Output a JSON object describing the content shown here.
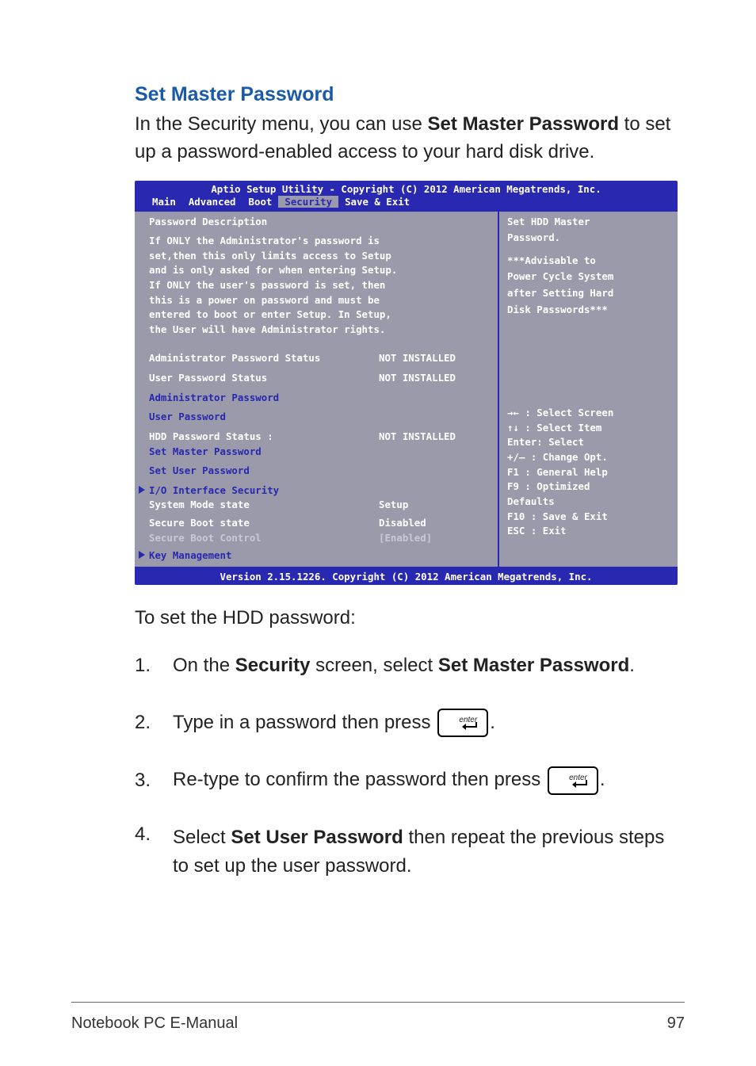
{
  "heading": "Set Master Password",
  "intro_before": "In the Security menu, you can use ",
  "intro_bold": "Set Master Password",
  "intro_after": " to set up a password-enabled access to your hard disk drive.",
  "bios": {
    "title": "Aptio Setup Utility - Copyright (C) 2012 American Megatrends, Inc.",
    "tabs": [
      "Main",
      "Advanced",
      "Boot",
      "Security",
      "Save & Exit"
    ],
    "active_tab_index": 3,
    "left": {
      "section_title": "Password Description",
      "desc_lines": [
        "If ONLY the Administrator's password is",
        "set,then this only limits access to Setup",
        "and is only asked for when entering Setup.",
        "If ONLY the user's password is set, then",
        "this is a power on password and must be",
        "entered to boot or enter Setup. In Setup,",
        "the User will have Administrator rights."
      ],
      "admin_status_label": "Administrator Password Status",
      "admin_status_val": "NOT INSTALLED",
      "user_status_label": "User Password Status",
      "user_status_val": "NOT INSTALLED",
      "admin_pw": "Administrator Password",
      "user_pw": "User Password",
      "hdd_status_label": "HDD Password Status :",
      "hdd_status_val": "NOT INSTALLED",
      "set_master": "Set Master Password",
      "set_user": "Set User Password",
      "io_sec": "I/O Interface Security",
      "sys_mode_label": "System Mode state",
      "sys_mode_val": "Setup",
      "sec_boot_state_label": "Secure Boot state",
      "sec_boot_state_val": "Disabled",
      "sec_boot_ctrl_label": "Secure Boot Control",
      "sec_boot_ctrl_val": "[Enabled]",
      "key_mgmt": "Key Management"
    },
    "right": {
      "help_lines": [
        "Set HDD Master",
        "Password.",
        "",
        "***Advisable to",
        "Power Cycle System",
        "after Setting Hard",
        "Disk Passwords***"
      ],
      "key_lines": [
        "→←  : Select Screen",
        "↑↓  : Select Item",
        "Enter: Select",
        "+/—  : Change Opt.",
        "F1   : General Help",
        "F9   : Optimized",
        "Defaults",
        "F10  : Save & Exit",
        "ESC  : Exit"
      ]
    },
    "bottom": "Version 2.15.1226. Copyright (C) 2012 American Megatrends, Inc."
  },
  "subtext": "To set the HDD password:",
  "steps": {
    "1": {
      "num": "1.",
      "a": "On the ",
      "b1": "Security",
      "c": " screen, select ",
      "b2": "Set Master Password",
      "d": "."
    },
    "2": {
      "num": "2.",
      "text_before": "Type in a password then press ",
      "key_label": "enter",
      "text_after": "."
    },
    "3": {
      "num": "3.",
      "text_before": "Re-type to confirm the password then press ",
      "key_label": "enter",
      "text_after": "."
    },
    "4": {
      "num": "4.",
      "a": "Select ",
      "b": "Set User Password",
      "c": " then repeat the previous steps to set up the user password."
    }
  },
  "footer": {
    "left": "Notebook PC E-Manual",
    "right": "97"
  }
}
